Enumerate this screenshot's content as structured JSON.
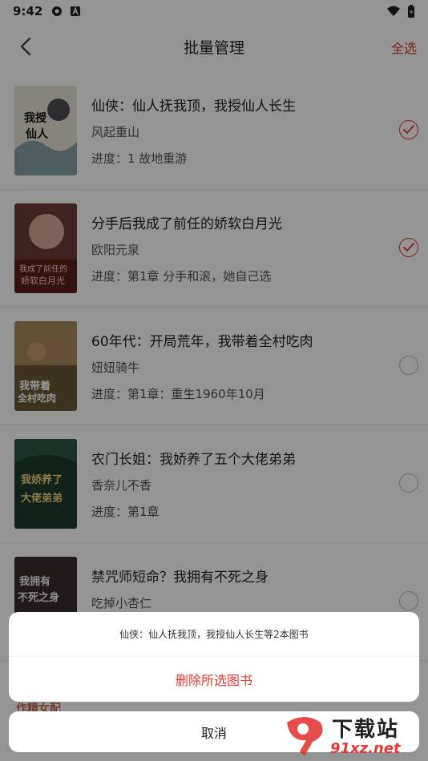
{
  "status_bar": {
    "time": "9:42"
  },
  "header": {
    "title": "批量管理",
    "select_all": "全选"
  },
  "books": [
    {
      "title": "仙侠：仙人抚我顶，我授仙人长生",
      "author": "风起重山",
      "progress": "进度：1 故地重游",
      "selected": true,
      "cover_text": "我授仙人长生"
    },
    {
      "title": "分手后我成了前任的娇软白月光",
      "author": "欧阳元泉",
      "progress": "进度：第1章 分手和滚，她自己选",
      "selected": true,
      "cover_text": "我成了前任的娇软白月光"
    },
    {
      "title": "60年代：开局荒年，我带着全村吃肉",
      "author": "妞妞骑牛",
      "progress": "进度：第1章：重生1960年10月",
      "selected": false,
      "cover_text": "我带着全村吃肉"
    },
    {
      "title": "农门长姐：我娇养了五个大佬弟弟",
      "author": "香奈儿不香",
      "progress": "进度：第1章",
      "selected": false,
      "cover_text": "我娇养了五个大佬弟弟"
    },
    {
      "title": "禁咒师短命？我拥有不死之身",
      "author": "吃掉小杏仁",
      "progress": "",
      "selected": false,
      "cover_text": "我拥有不死之身"
    }
  ],
  "action_sheet": {
    "message": "仙侠：仙人抚我顶，我授仙人长生等2本图书",
    "delete_label": "删除所选图书",
    "cancel_label": "取消"
  },
  "bottom_peek": {
    "text": "作精女配"
  },
  "watermark": {
    "main": "下载站",
    "url": "91xz.net"
  },
  "colors": {
    "accent": "#e53935",
    "overlay": "rgba(0,0,0,0.42)"
  }
}
